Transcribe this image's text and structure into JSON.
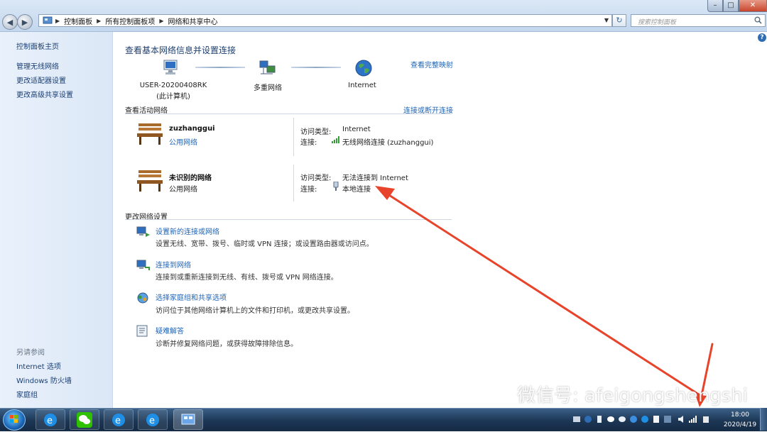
{
  "address_bar": {
    "breadcrumbs": [
      "控制面板",
      "所有控制面板项",
      "网络和共享中心"
    ],
    "search_placeholder": "搜索控制面板"
  },
  "sidebar": {
    "items": [
      {
        "label": "控制面板主页"
      },
      {
        "label": "管理无线网络"
      },
      {
        "label": "更改适配器设置"
      },
      {
        "label": "更改高级共享设置"
      }
    ],
    "see_also_label": "另请参阅",
    "see_also_items": [
      {
        "label": "Internet 选项"
      },
      {
        "label": "Windows 防火墙"
      },
      {
        "label": "家庭组"
      }
    ]
  },
  "main": {
    "title": "查看基本网络信息并设置连接",
    "map_link": "查看完整映射",
    "network_map": {
      "computer_name": "USER-20200408RK",
      "computer_sub": "(此计算机)",
      "middle": "多重网络",
      "internet": "Internet"
    },
    "active_networks_label": "查看活动网络",
    "connect_disconnect_link": "连接或断开连接",
    "networks": [
      {
        "name": "zuzhanggui",
        "type": "公用网络",
        "access_key": "访问类型:",
        "access_value": "Internet",
        "conn_key": "连接:",
        "conn_value": "无线网络连接 (zuzhanggui)"
      },
      {
        "name": "未识别的网络",
        "type": "公用网络",
        "access_key": "访问类型:",
        "access_value": "无法连接到 Internet",
        "conn_key": "连接:",
        "conn_value": "本地连接"
      }
    ],
    "change_settings_label": "更改网络设置",
    "tasks": [
      {
        "link": "设置新的连接或网络",
        "desc": "设置无线、宽带、拨号、临时或 VPN 连接；或设置路由器或访问点。"
      },
      {
        "link": "连接到网络",
        "desc": "连接到或重新连接到无线、有线、拨号或 VPN 网络连接。"
      },
      {
        "link": "选择家庭组和共享选项",
        "desc": "访问位于其他网络计算机上的文件和打印机，或更改共享设置。"
      },
      {
        "link": "疑难解答",
        "desc": "诊断并修复网络问题，或获得故障排除信息。"
      }
    ]
  },
  "watermark": "微信号: afeigongshengshi",
  "taskbar": {
    "clock_time": "18:00",
    "clock_date": "2020/4/19",
    "pinned": [
      "ie-icon",
      "wechat-icon",
      "ie-icon",
      "ie-icon",
      "control-panel-icon"
    ]
  },
  "colors": {
    "link": "#1f64b5",
    "annotation_arrow": "#e8432b",
    "taskbar": "#1c3654"
  }
}
